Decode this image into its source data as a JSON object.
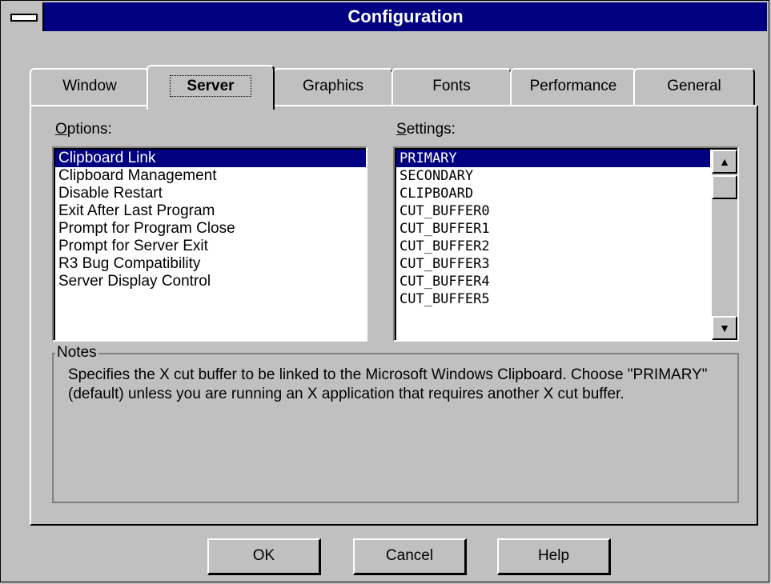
{
  "window": {
    "title": "Configuration"
  },
  "tabs": [
    {
      "label": "Window",
      "active": false
    },
    {
      "label": "Server",
      "active": true
    },
    {
      "label": "Graphics",
      "active": false
    },
    {
      "label": "Fonts",
      "active": false
    },
    {
      "label": "Performance",
      "active": false
    },
    {
      "label": "General",
      "active": false
    }
  ],
  "options": {
    "label_accel": "O",
    "label_rest": "ptions:",
    "items": [
      "Clipboard Link",
      "Clipboard Management",
      "Disable Restart",
      "Exit After Last Program",
      "Prompt for Program Close",
      "Prompt for Server Exit",
      "R3 Bug Compatibility",
      "Server Display Control"
    ],
    "selected": "Clipboard Link"
  },
  "settings": {
    "label_accel": "S",
    "label_rest": "ettings:",
    "items": [
      "PRIMARY",
      "SECONDARY",
      "CLIPBOARD",
      "CUT_BUFFER0",
      "CUT_BUFFER1",
      "CUT_BUFFER2",
      "CUT_BUFFER3",
      "CUT_BUFFER4",
      "CUT_BUFFER5"
    ],
    "selected": "PRIMARY",
    "scroll_up_icon": "arrow-up-icon",
    "scroll_down_icon": "arrow-down-icon"
  },
  "notes": {
    "title": "Notes",
    "text": "Specifies the X cut buffer to be linked to the Microsoft Windows Clipboard. Choose \"PRIMARY\" (default) unless you are running an X application that requires another X cut buffer."
  },
  "buttons": {
    "ok": "OK",
    "cancel": "Cancel",
    "help": "Help"
  },
  "colors": {
    "face": "#c0c0c0",
    "titlebar": "#000080",
    "selection": "#000080"
  }
}
